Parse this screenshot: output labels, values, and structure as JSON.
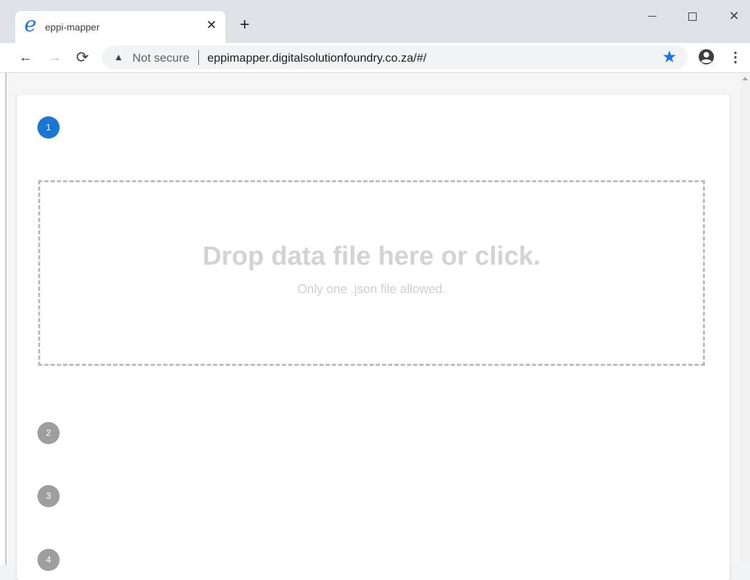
{
  "browser": {
    "tab": {
      "title": "eppi-mapper",
      "favicon_glyph": "e",
      "close_glyph": "✕"
    },
    "new_tab_glyph": "+",
    "window_controls": {
      "close_glyph": "✕"
    },
    "nav": {
      "back_glyph": "←",
      "forward_glyph": "→",
      "reload_glyph": "⟳"
    },
    "omnibox": {
      "security_glyph": "▲",
      "security_text": "Not secure",
      "url": "eppimapper.digitalsolutionfoundry.co.za/#/",
      "star_glyph": "★"
    },
    "menu_glyph": "⋮"
  },
  "stepper": {
    "steps": [
      {
        "number": "1",
        "state": "active"
      },
      {
        "number": "2",
        "state": "inactive"
      },
      {
        "number": "3",
        "state": "inactive"
      },
      {
        "number": "4",
        "state": "inactive"
      }
    ]
  },
  "dropzone": {
    "title": "Drop data file here or click.",
    "subtitle": "Only one .json file allowed."
  },
  "colors": {
    "accent": "#1976d2",
    "inactive_step": "#9e9e9e",
    "bookmark_star": "#1a73e8",
    "dropzone_border": "#bdbdbd"
  }
}
